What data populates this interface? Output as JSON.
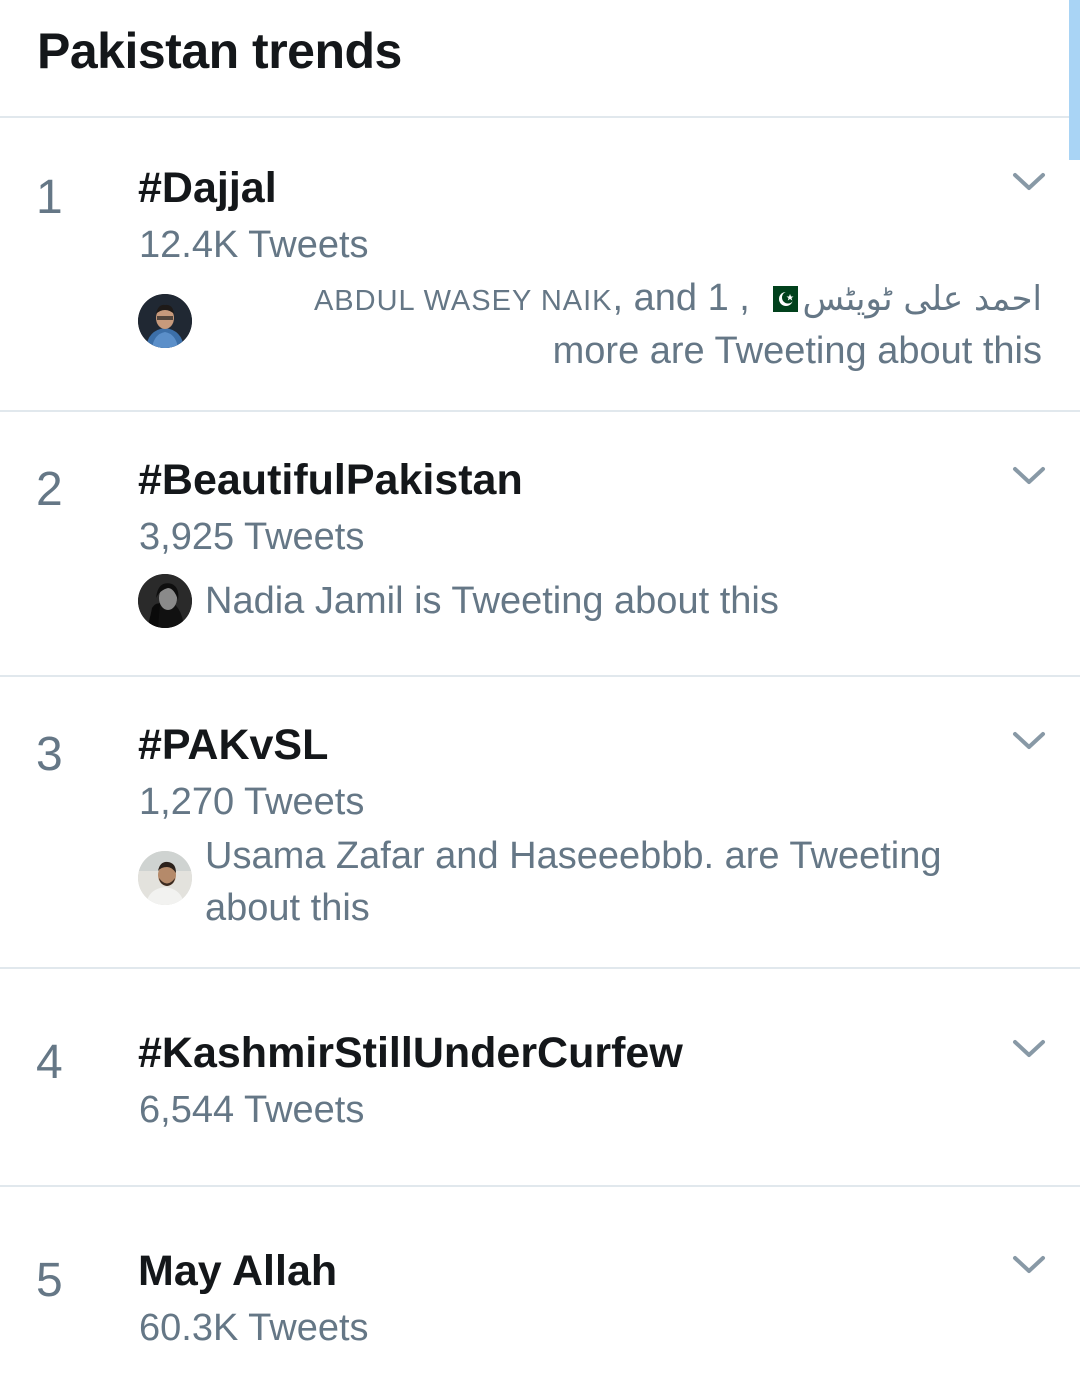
{
  "header": {
    "title": "Pakistan trends"
  },
  "trends": [
    {
      "rank": "1",
      "name": "#Dajjal",
      "count": "12.4K Tweets",
      "context_line1_rtl": "احمد علی ٹویٹس",
      "context_line1_names": "ABDUL WASEY NAIK",
      "context_line1_tail": ", and 1",
      "context_line2": "more are Tweeting about this"
    },
    {
      "rank": "2",
      "name": "#BeautifulPakistan",
      "count": "3,925 Tweets",
      "context": "Nadia Jamil is Tweeting about this"
    },
    {
      "rank": "3",
      "name": "#PAKvSL",
      "count": "1,270 Tweets",
      "context_line1": "Usama Zafar and Haseeebbb. are Tweeting",
      "context_line2": "about this"
    },
    {
      "rank": "4",
      "name": "#KashmirStillUnderCurfew",
      "count": "6,544 Tweets"
    },
    {
      "rank": "5",
      "name": "May Allah",
      "count": "60.3K Tweets"
    }
  ],
  "icons": {
    "chevron": "chevron-down-icon",
    "flag": "pakistan-flag-icon"
  },
  "colors": {
    "text_primary": "#14171a",
    "text_secondary": "#657786",
    "divider": "#e1e8ed",
    "scroll": "#a9d4f5"
  }
}
